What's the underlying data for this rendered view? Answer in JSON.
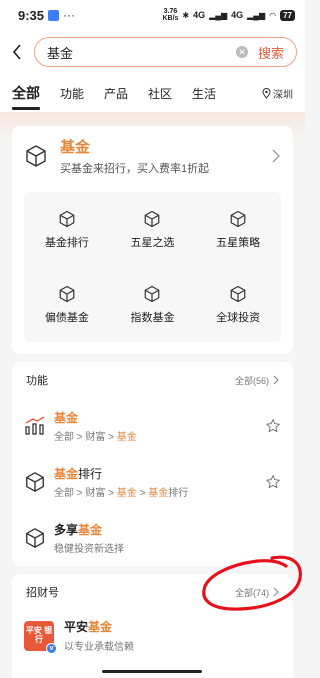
{
  "status_bar": {
    "time": "9:35",
    "dots": "···",
    "speed_value": "3.76",
    "speed_unit": "KB/s",
    "signal1": "4G",
    "signal2": "4G",
    "battery": "77"
  },
  "search": {
    "query": "基金",
    "search_button": "搜索"
  },
  "tabs": [
    "全部",
    "功能",
    "产品",
    "社区",
    "生活"
  ],
  "location": "深圳",
  "main_card": {
    "title": "基金",
    "subtitle": "买基金来招行，买入费率1折起",
    "grid": [
      "基金排行",
      "五星之选",
      "五星策略",
      "偏债基金",
      "指数基金",
      "全球投资"
    ]
  },
  "functions": {
    "title": "功能",
    "more": "全部(56)",
    "items": [
      {
        "name_hl": "基金",
        "name_rest": "",
        "path_pre": "全部 > 财富 > ",
        "path_hl": "基金",
        "path_post": ""
      },
      {
        "name_hl": "基金",
        "name_rest": "排行",
        "path_pre": "全部 > 财富 > ",
        "path_hl": "基金",
        "path_mid": " > ",
        "path_hl2": "基金",
        "path_post": "排行"
      },
      {
        "name_pre": "多享",
        "name_hl": "基金",
        "desc": "稳健投资新选择"
      }
    ]
  },
  "zcf": {
    "title": "招财号",
    "more": "全部(74)",
    "item": {
      "avatar_text": "平安 银行",
      "name_pre": "平安",
      "name_hl": "基金",
      "desc": "以专业承载信赖"
    }
  },
  "colors": {
    "accent": "#e8873a",
    "search_red": "#e8593a",
    "annotation": "#e8101a"
  }
}
